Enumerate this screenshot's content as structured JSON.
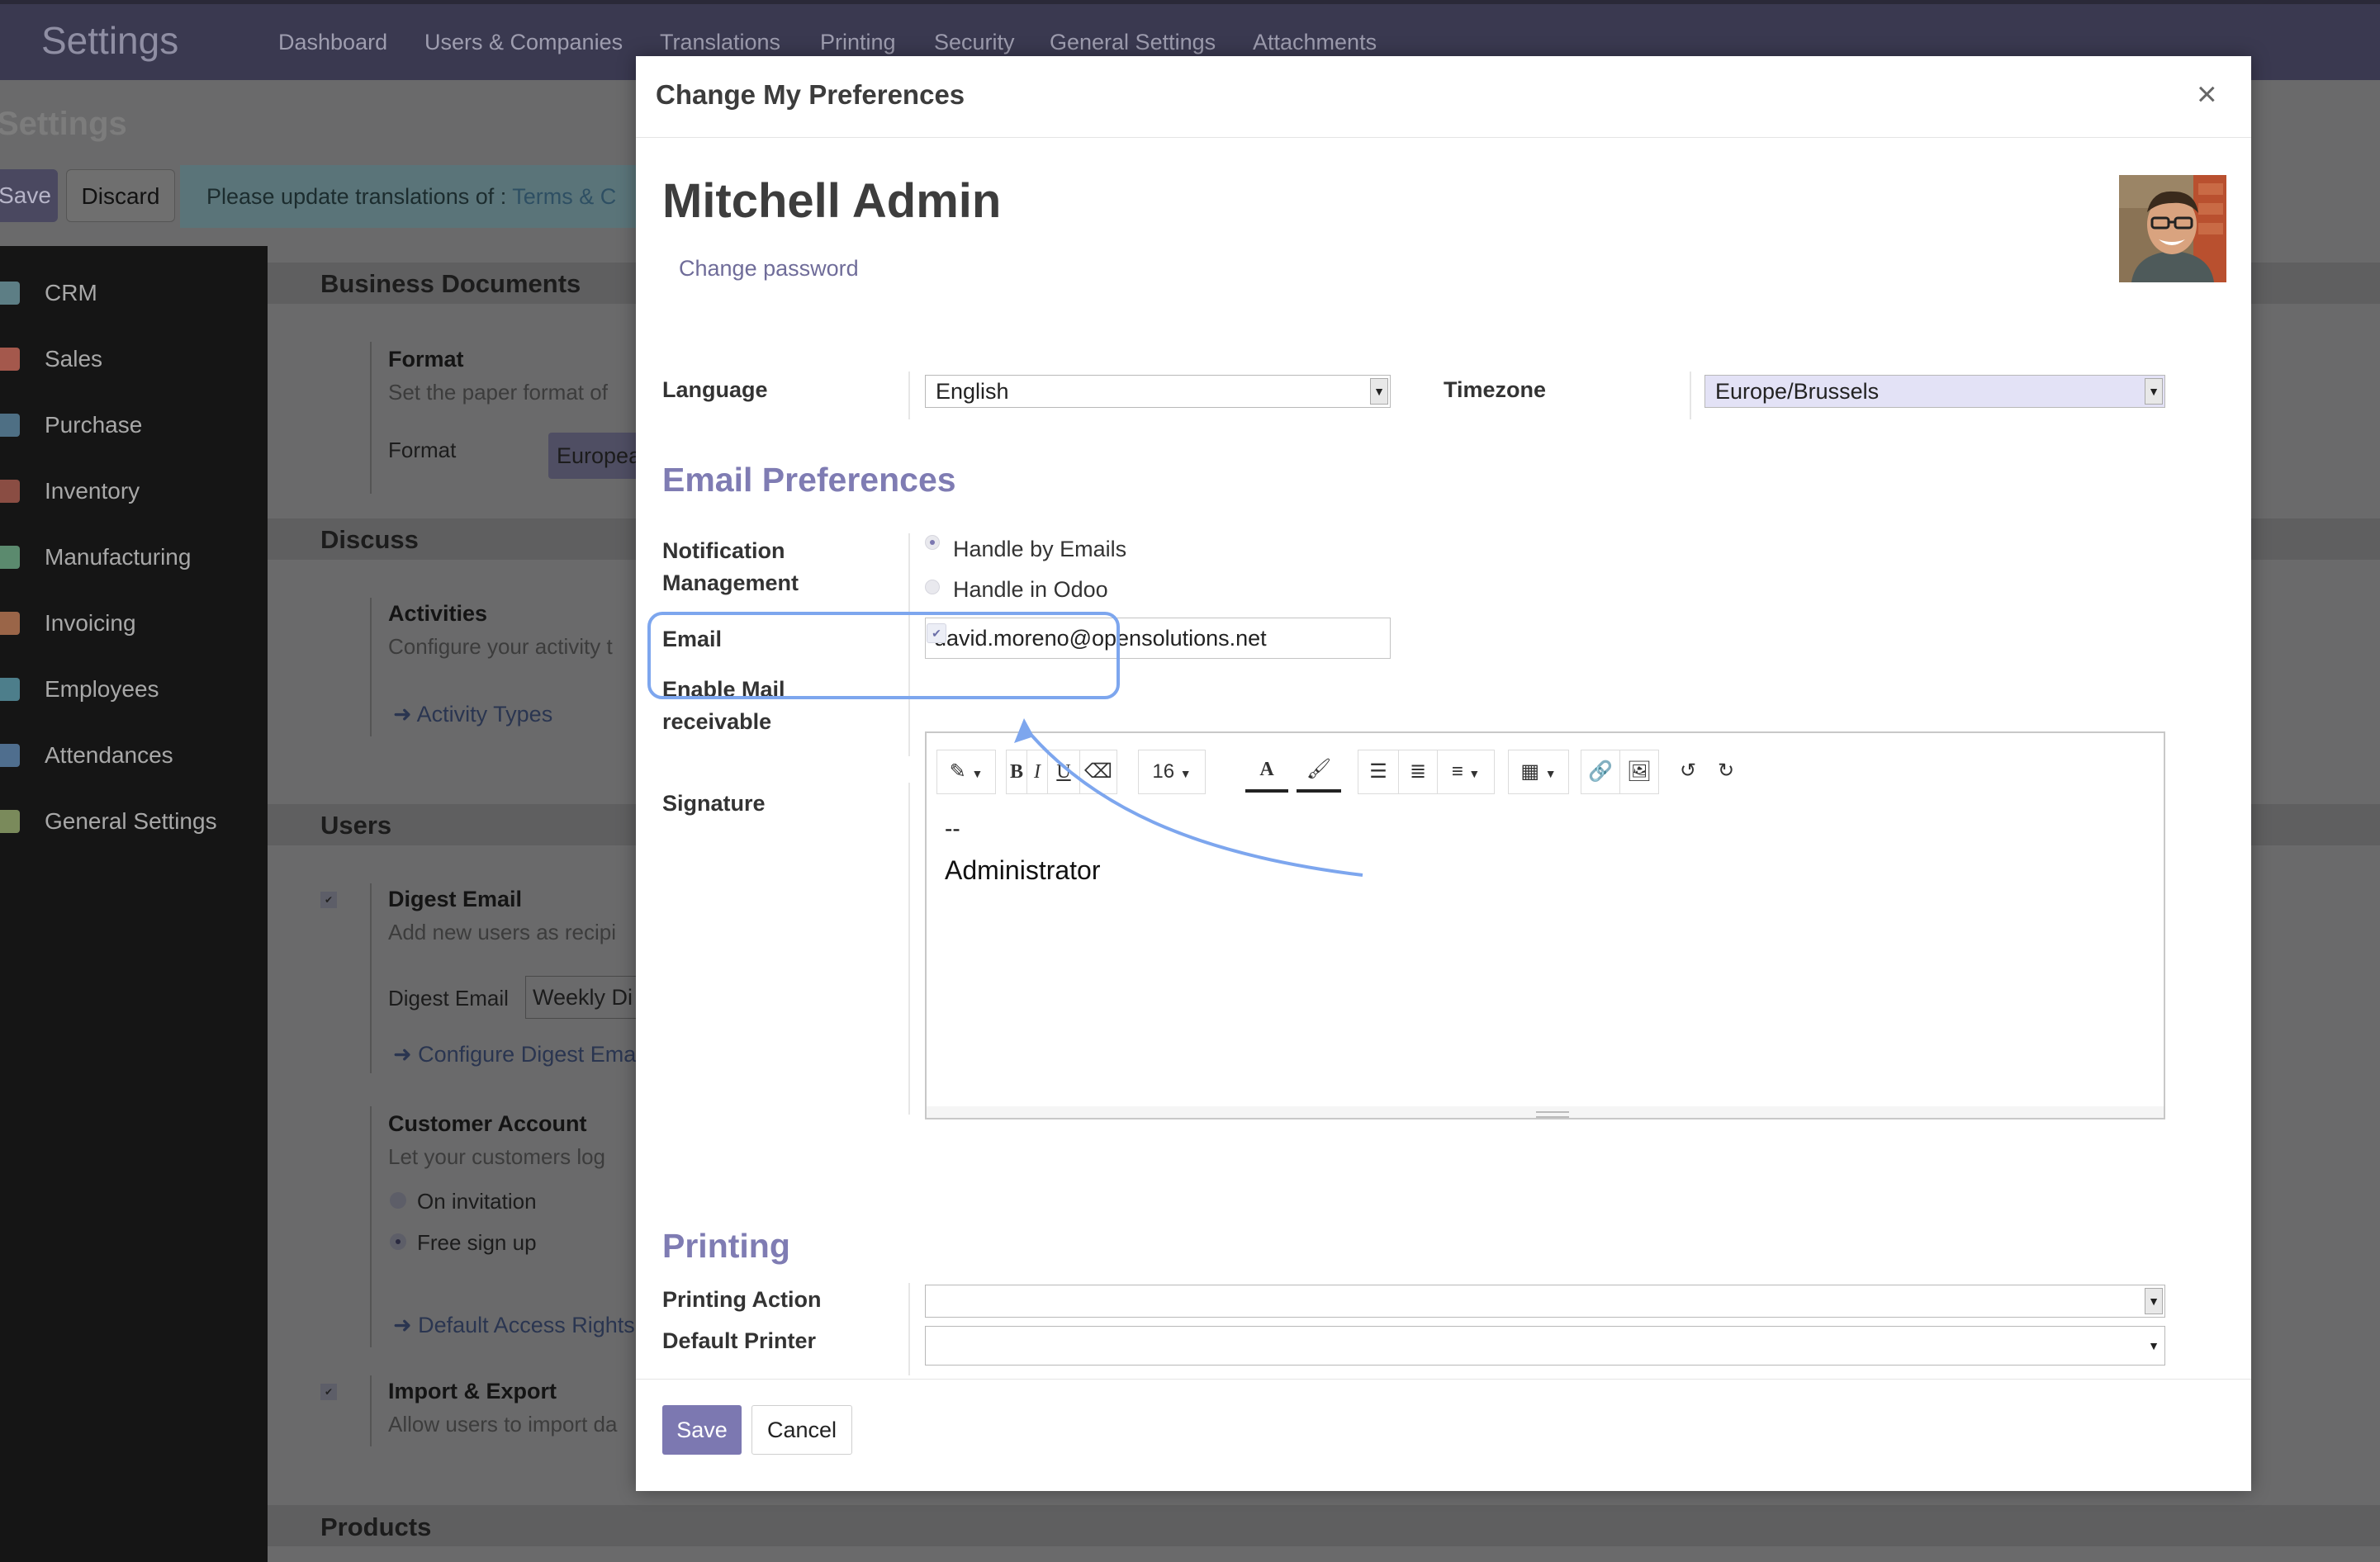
{
  "app": {
    "title": "Settings"
  },
  "topnav": [
    "Dashboard",
    "Users & Companies",
    "Translations",
    "Printing",
    "Security",
    "General Settings",
    "Attachments"
  ],
  "background": {
    "page_title": "Settings",
    "save_label": "Save",
    "discard_label": "Discard",
    "alert_prefix": "Please update translations of : ",
    "alert_link": "Terms & C",
    "sidebar": [
      {
        "label": "CRM",
        "icon": "crm-icon",
        "color": "#5d7e85"
      },
      {
        "label": "Sales",
        "icon": "sales-icon",
        "color": "#a4584c"
      },
      {
        "label": "Purchase",
        "icon": "purchase-icon",
        "color": "#4e6f84"
      },
      {
        "label": "Inventory",
        "icon": "inventory-icon",
        "color": "#8a4d43"
      },
      {
        "label": "Manufacturing",
        "icon": "manufacturing-icon",
        "color": "#5b8a6e"
      },
      {
        "label": "Invoicing",
        "icon": "invoicing-icon",
        "color": "#9a6548"
      },
      {
        "label": "Employees",
        "icon": "employees-icon",
        "color": "#4d7e8b"
      },
      {
        "label": "Attendances",
        "icon": "attendances-icon",
        "color": "#4f6e8e"
      },
      {
        "label": "General Settings",
        "icon": "gear-icon",
        "color": "#7a8a5b"
      }
    ],
    "sections": {
      "business_documents": "Business Documents",
      "format_title": "Format",
      "format_desc": "Set the paper format of",
      "format_label": "Format",
      "format_value": "Europea",
      "discuss": "Discuss",
      "activities_title": "Activities",
      "activities_desc": "Configure your activity t",
      "activity_types": "Activity Types",
      "users": "Users",
      "digest_title": "Digest Email",
      "digest_desc": "Add new users as recipi",
      "digest_label": "Digest Email",
      "digest_value": "Weekly Di",
      "configure_digest": "Configure Digest Ema",
      "customer_account_title": "Customer Account",
      "customer_account_desc": "Let your customers log",
      "on_invitation": "On invitation",
      "free_sign_up": "Free sign up",
      "default_access": "Default Access Rights",
      "import_export_title": "Import & Export",
      "import_export_desc": "Allow users to import da",
      "products": "Products"
    }
  },
  "modal": {
    "title": "Change My Preferences",
    "close_glyph": "×",
    "user_name": "Mitchell Admin",
    "change_password": "Change password",
    "language_label": "Language",
    "language_value": "English",
    "timezone_label": "Timezone",
    "timezone_value": "Europe/Brussels",
    "email_prefs_heading": "Email Preferences",
    "notification_label_1": "Notification",
    "notification_label_2": "Management",
    "notification_options": [
      "Handle by Emails",
      "Handle in Odoo"
    ],
    "notification_selected": "Handle by Emails",
    "email_label": "Email",
    "email_value": "david.moreno@opensolutions.net",
    "enable_mail_label_1": "Enable Mail",
    "enable_mail_label_2": "receivable",
    "enable_mail_checked": true,
    "signature_label": "Signature",
    "toolbar": {
      "font_size": "16",
      "bold": "B",
      "italic": "I",
      "underline": "U",
      "text_color": "A"
    },
    "signature_lines": [
      "--",
      "Administrator"
    ],
    "printing_heading": "Printing",
    "printing_action_label": "Printing Action",
    "printing_action_value": "",
    "default_printer_label": "Default Printer",
    "default_printer_value": "",
    "save_label": "Save",
    "cancel_label": "Cancel"
  },
  "colors": {
    "accent": "#7c78b1",
    "topbar": "#3a3950",
    "highlight": "#7da6ee"
  }
}
